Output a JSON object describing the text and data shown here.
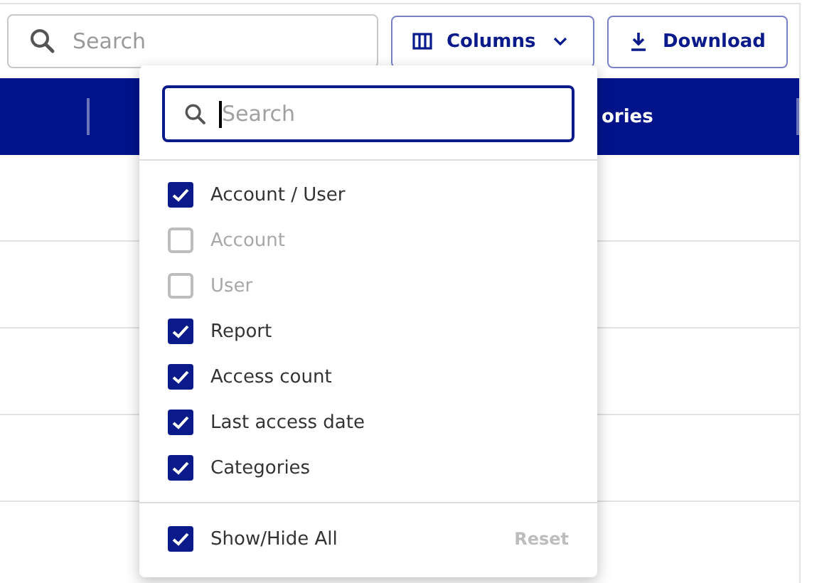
{
  "toolbar": {
    "search": {
      "placeholder": "Search"
    },
    "columns_button": {
      "label": "Columns"
    },
    "download_button": {
      "label": "Download"
    }
  },
  "table": {
    "header_visible_text": "ories"
  },
  "columns_menu": {
    "search": {
      "placeholder": "Search",
      "focused": true
    },
    "items": [
      {
        "label": "Account / User",
        "checked": true,
        "disabled": false
      },
      {
        "label": "Account",
        "checked": false,
        "disabled": true
      },
      {
        "label": "User",
        "checked": false,
        "disabled": true
      },
      {
        "label": "Report",
        "checked": true,
        "disabled": false
      },
      {
        "label": "Access count",
        "checked": true,
        "disabled": false
      },
      {
        "label": "Last access date",
        "checked": true,
        "disabled": false
      },
      {
        "label": "Categories",
        "checked": true,
        "disabled": false
      }
    ],
    "show_hide_all": {
      "label": "Show/Hide All",
      "checked": true
    },
    "reset": {
      "label": "Reset",
      "disabled": true
    }
  }
}
